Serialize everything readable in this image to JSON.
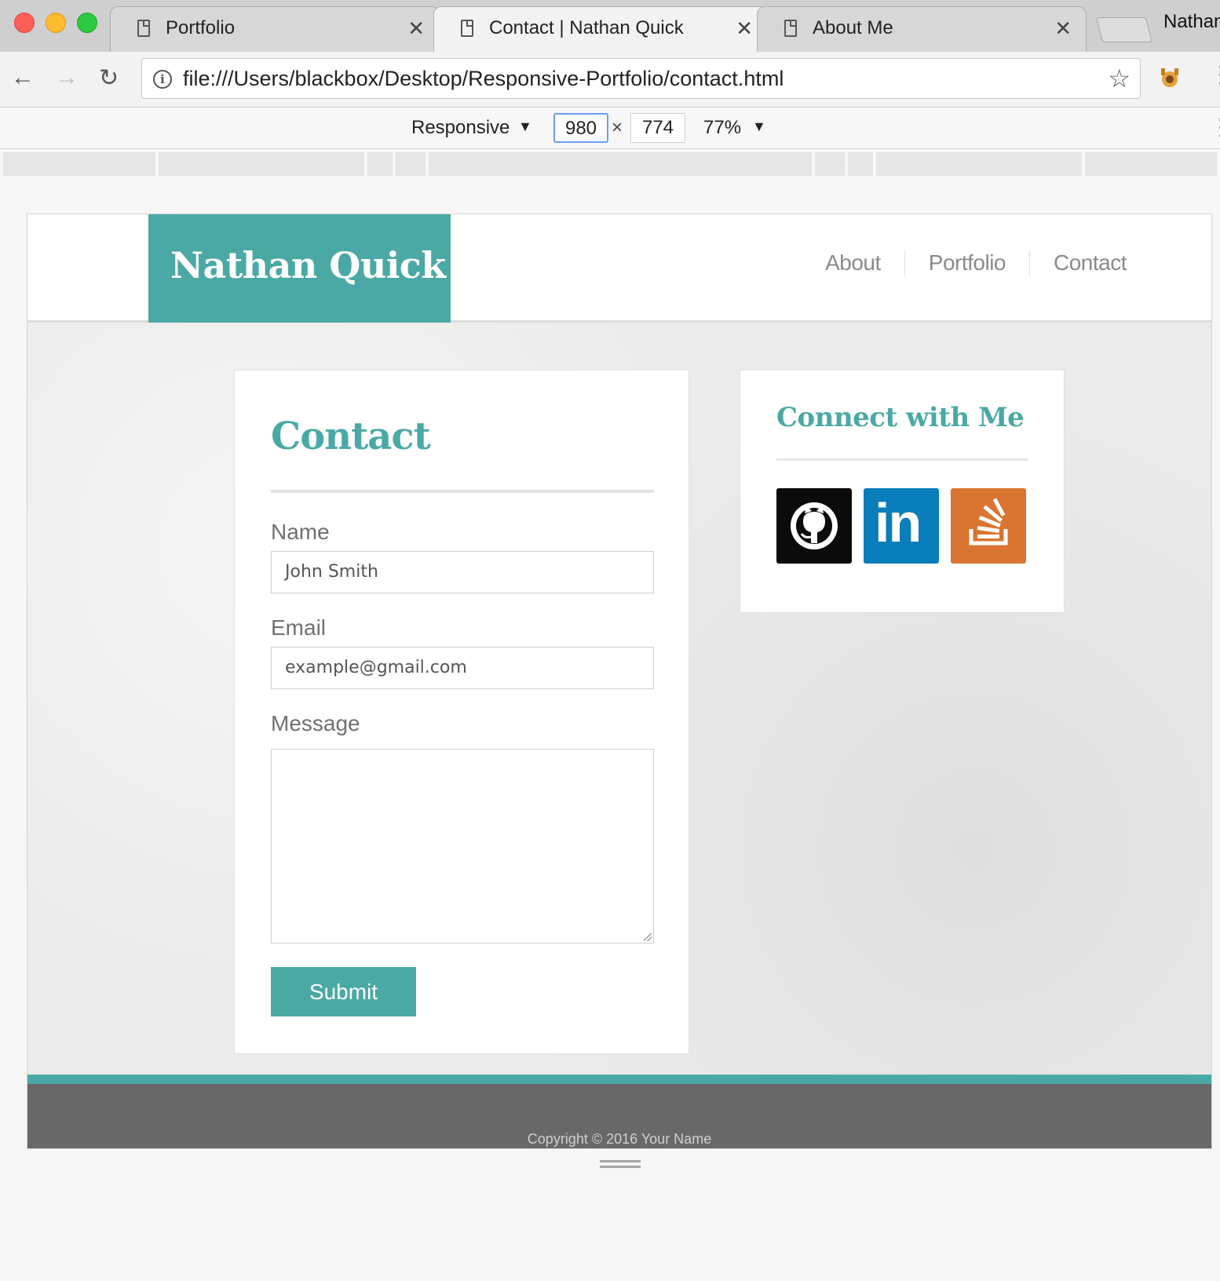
{
  "browser": {
    "tabs": [
      {
        "title": "Portfolio",
        "close": "✕"
      },
      {
        "title": "Contact | Nathan Quick",
        "close": "✕"
      },
      {
        "title": "About Me",
        "close": "✕"
      }
    ],
    "profile_name": "Nathan",
    "url": "file:///Users/blackbox/Desktop/Responsive-Portfolio/contact.html",
    "icons": {
      "back": "←",
      "forward": "→",
      "reload": "↻",
      "info": "i",
      "star": "☆",
      "menu": "⋮"
    }
  },
  "device_toolbar": {
    "device": "Responsive",
    "width": "980",
    "height": "774",
    "times": "×",
    "zoom": "77%",
    "caret": "▼"
  },
  "site": {
    "logo": "Nathan Quick",
    "nav": [
      "About",
      "Portfolio",
      "Contact"
    ],
    "contact": {
      "title": "Contact",
      "name_label": "Name",
      "name_placeholder": "John Smith",
      "email_label": "Email",
      "email_placeholder": "example@gmail.com",
      "message_label": "Message",
      "submit": "Submit"
    },
    "social": {
      "title": "Connect with Me",
      "icons": [
        "github-icon",
        "linkedin-icon",
        "stackoverflow-icon"
      ],
      "linkedin_text": "in"
    },
    "footer": "Copyright © 2016 Your Name"
  },
  "colors": {
    "accent": "#4aa9a4",
    "github": "#0b0b0b",
    "linkedin": "#0a7dbb",
    "stackoverflow": "#d97530",
    "footer": "#686868"
  }
}
